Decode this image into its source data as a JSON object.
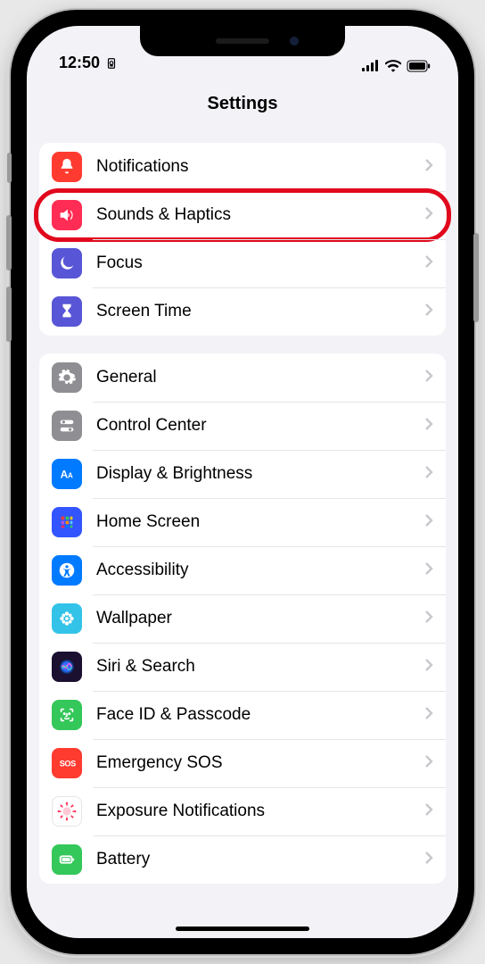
{
  "status": {
    "time": "12:50"
  },
  "header": {
    "title": "Settings"
  },
  "groups": [
    {
      "items": [
        {
          "id": "notifications",
          "label": "Notifications",
          "icon": "bell-icon",
          "color": "#ff3b30"
        },
        {
          "id": "sounds",
          "label": "Sounds & Haptics",
          "icon": "speaker-icon",
          "color": "#ff2d55",
          "highlight": true
        },
        {
          "id": "focus",
          "label": "Focus",
          "icon": "moon-icon",
          "color": "#5856d6"
        },
        {
          "id": "screentime",
          "label": "Screen Time",
          "icon": "hourglass-icon",
          "color": "#5856d6"
        }
      ]
    },
    {
      "items": [
        {
          "id": "general",
          "label": "General",
          "icon": "gear-icon",
          "color": "#8e8e93"
        },
        {
          "id": "controlcenter",
          "label": "Control Center",
          "icon": "switches-icon",
          "color": "#8e8e93"
        },
        {
          "id": "display",
          "label": "Display & Brightness",
          "icon": "aa-icon",
          "color": "#007aff"
        },
        {
          "id": "homescreen",
          "label": "Home Screen",
          "icon": "grid-icon",
          "color": "#3355ff"
        },
        {
          "id": "accessibility",
          "label": "Accessibility",
          "icon": "person-icon",
          "color": "#007aff"
        },
        {
          "id": "wallpaper",
          "label": "Wallpaper",
          "icon": "flower-icon",
          "color": "#33c3e8"
        },
        {
          "id": "siri",
          "label": "Siri & Search",
          "icon": "siri-icon",
          "color": "#000000"
        },
        {
          "id": "faceid",
          "label": "Face ID & Passcode",
          "icon": "face-icon",
          "color": "#34c759"
        },
        {
          "id": "sos",
          "label": "Emergency SOS",
          "icon": "sos-icon",
          "color": "#ff3b30"
        },
        {
          "id": "exposure",
          "label": "Exposure Notifications",
          "icon": "covid-icon",
          "color": "#ffffff"
        },
        {
          "id": "battery",
          "label": "Battery",
          "icon": "battery-icon",
          "color": "#34c759"
        }
      ]
    }
  ]
}
